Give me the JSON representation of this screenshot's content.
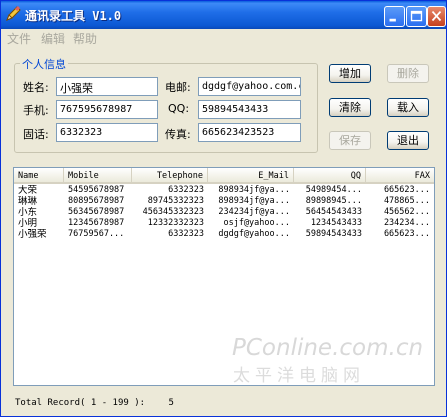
{
  "window": {
    "title": "通讯录工具 V1.0"
  },
  "menu": {
    "items": [
      "文件",
      "编辑",
      "帮助"
    ]
  },
  "form": {
    "group_title": "个人信息",
    "name_label": "姓名:",
    "name_value": "小强荣",
    "mobile_label": "手机:",
    "mobile_value": "767595678987",
    "phone_label": "固话:",
    "phone_value": "6332323",
    "email_label": "电邮:",
    "email_value": "dgdgf@yahoo.com.cn",
    "qq_label": "QQ:",
    "qq_value": "59894543433",
    "fax_label": "传真:",
    "fax_value": "665623423523"
  },
  "buttons": {
    "add": "增加",
    "delete": "删除",
    "clear": "清除",
    "load": "载入",
    "save": "保存",
    "exit": "退出"
  },
  "table": {
    "columns": [
      "Name",
      "Mobile",
      "Telephone",
      "E_Mail",
      "QQ",
      "FAX"
    ],
    "rows": [
      [
        "大荣",
        "54595678987",
        "6332323",
        "898934jf@ya...",
        "54989454...",
        "665623..."
      ],
      [
        "琳琳",
        "80895678987",
        "89745332323",
        "898934jf@ya...",
        "89898945...",
        "478865..."
      ],
      [
        "小东",
        "56345678987",
        "456345332323",
        "234234jf@ya...",
        "56454543433",
        "456562..."
      ],
      [
        "小明",
        "12345678987",
        "12332332323",
        "osjf@yahoo...",
        "1234543433",
        "234234..."
      ],
      [
        "小强荣",
        "76759567...",
        "6332323",
        "dgdgf@yahoo...",
        "59894543433",
        "665623..."
      ]
    ]
  },
  "status": {
    "text": "Total Record( 1 - 199 ):",
    "count": "5"
  },
  "watermark": {
    "brand": "PConline.com.cn",
    "cn": "太平洋电脑网"
  }
}
